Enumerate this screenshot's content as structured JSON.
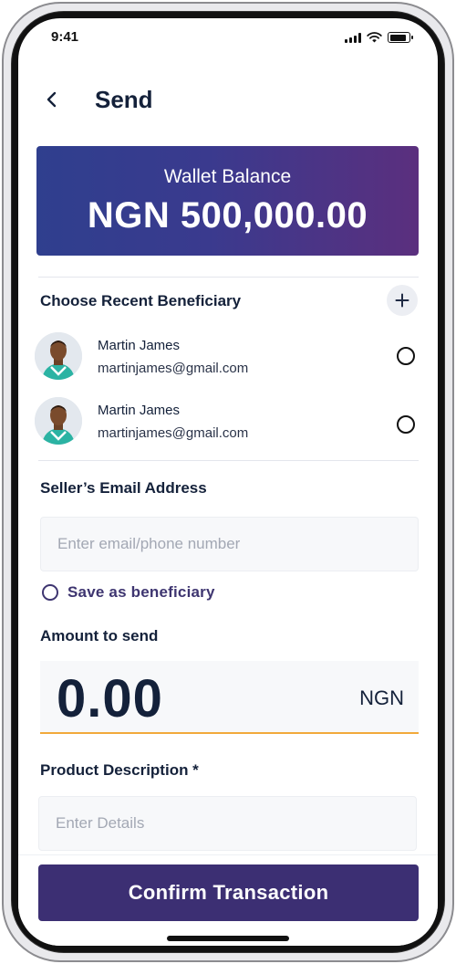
{
  "status_bar": {
    "time": "9:41",
    "battery_level": 0.85
  },
  "header": {
    "title": "Send",
    "back_icon": "chevron-left-icon"
  },
  "wallet": {
    "label": "Wallet Balance",
    "amount": "NGN 500,000.00"
  },
  "beneficiaries": {
    "section_label": "Choose Recent Beneficiary",
    "add_icon": "plus-icon",
    "items": [
      {
        "name": "Martin James",
        "email": "martinjames@gmail.com",
        "selected": false
      },
      {
        "name": "Martin James",
        "email": "martinjames@gmail.com",
        "selected": false
      }
    ]
  },
  "seller_email": {
    "label": "Seller’s Email Address",
    "placeholder": "Enter email/phone number",
    "value": ""
  },
  "save_beneficiary": {
    "label": "Save as beneficiary",
    "checked": false
  },
  "amount": {
    "label": "Amount to send",
    "value": "0.00",
    "currency": "NGN"
  },
  "product_description": {
    "label": "Product Description *",
    "placeholder": "Enter Details",
    "value": ""
  },
  "confirm_button": {
    "label": "Confirm Transaction"
  },
  "colors": {
    "primary": "#3c2f73",
    "card_gradient_start": "#2f3f8e",
    "card_gradient_end": "#5b2f7e",
    "accent_underline": "#f2a93b",
    "text_dark": "#14213a"
  }
}
